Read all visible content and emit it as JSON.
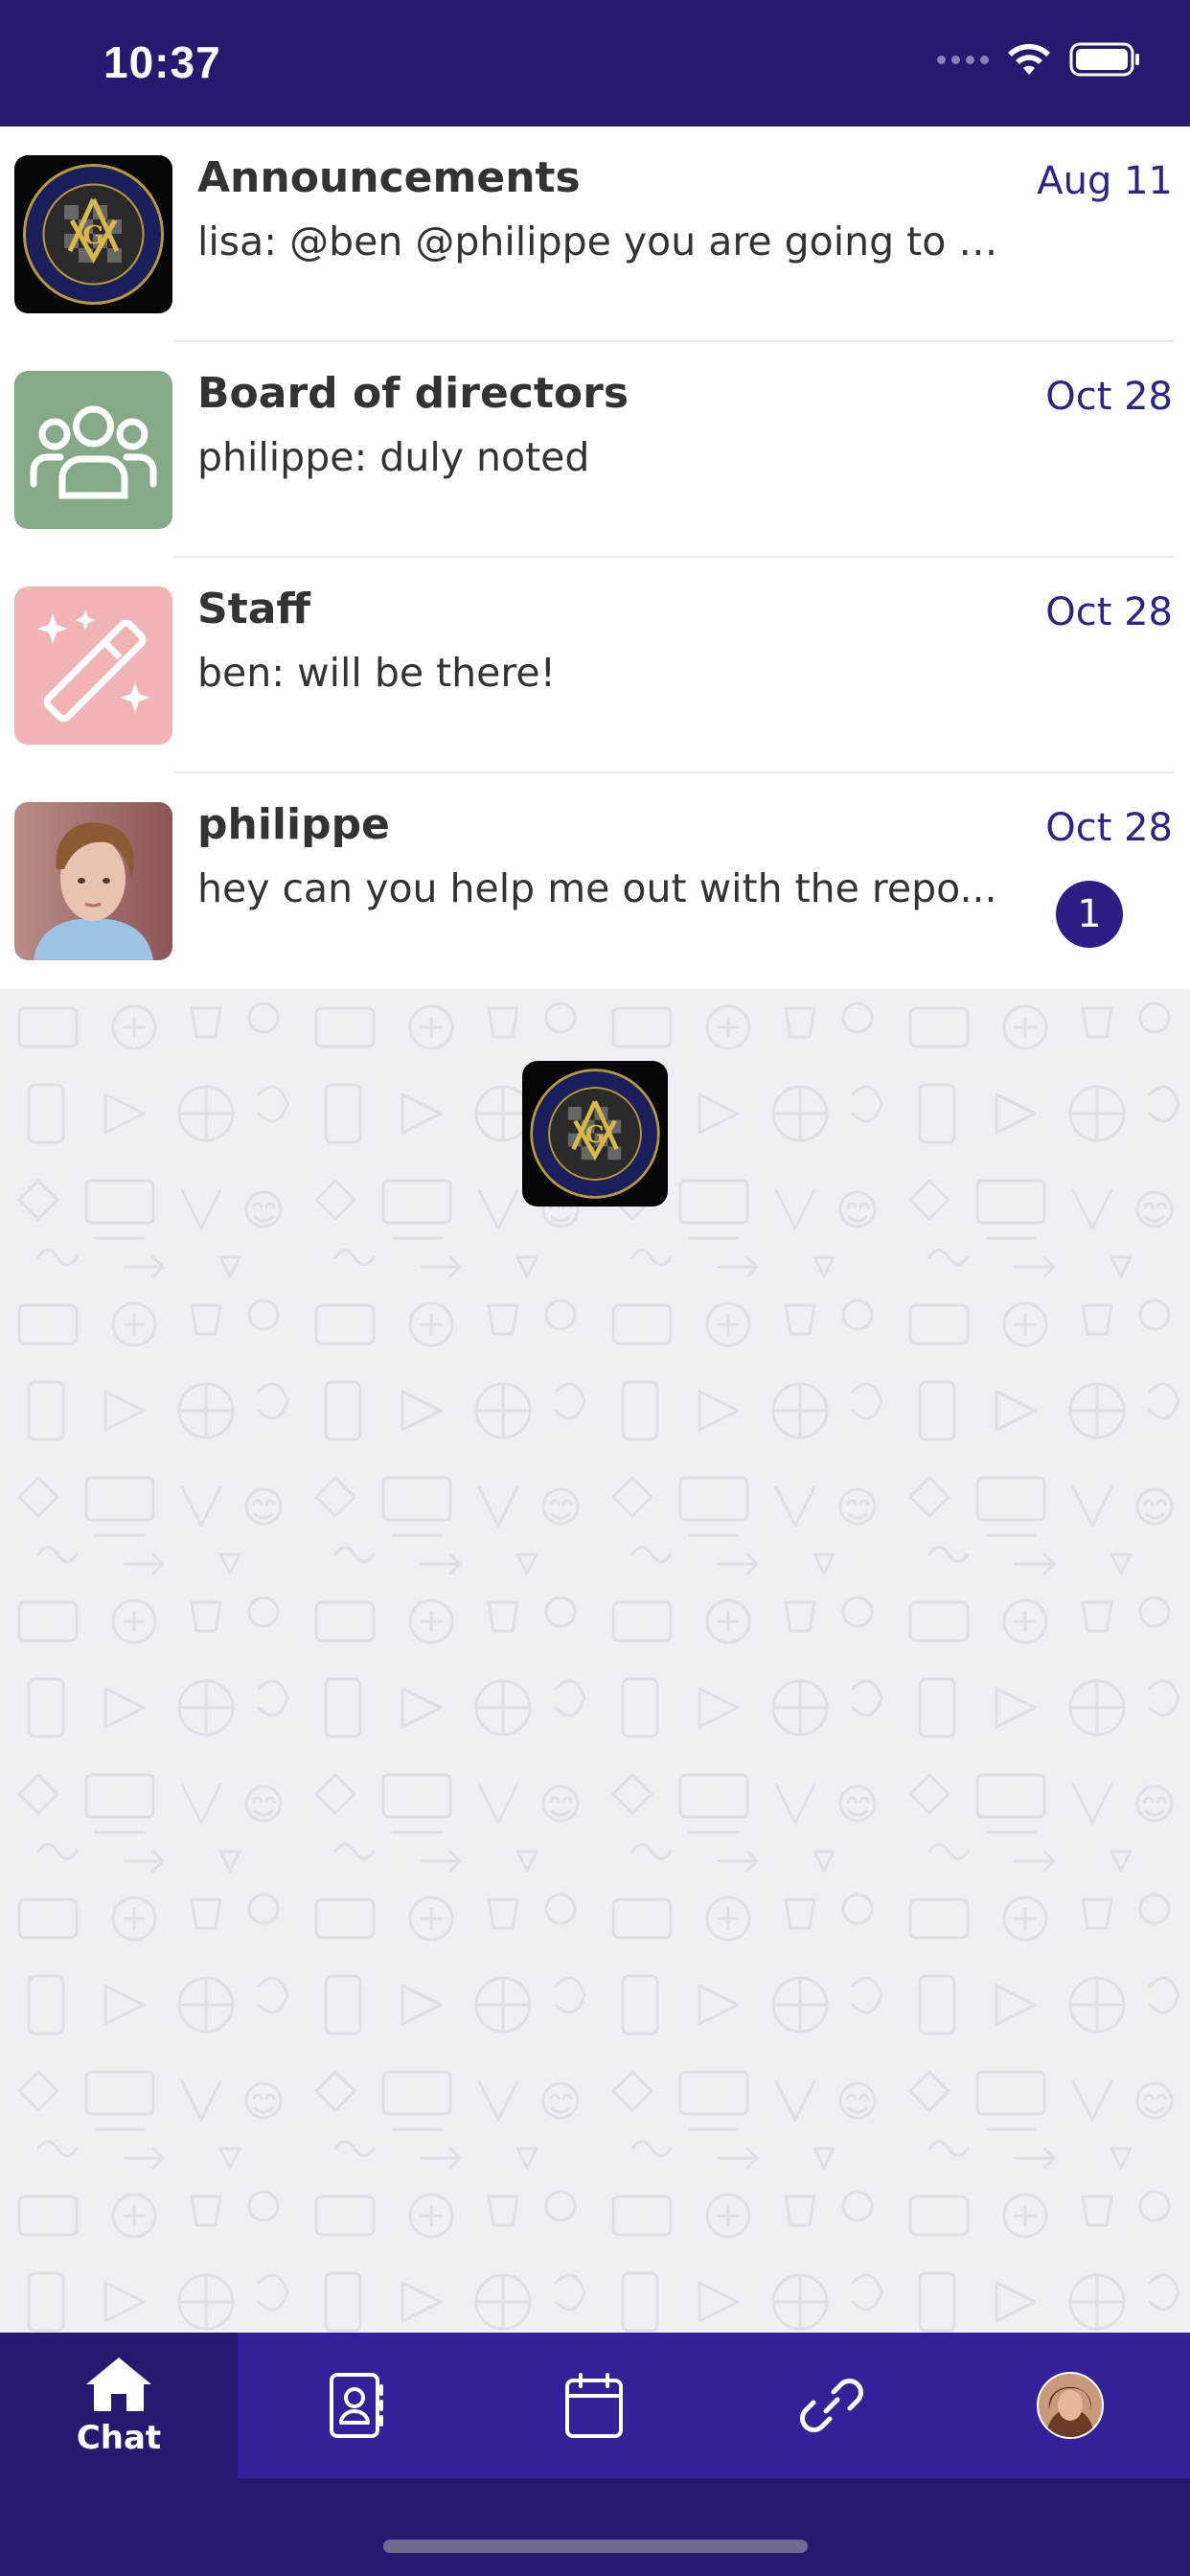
{
  "status_bar": {
    "time": "10:37"
  },
  "chats": [
    {
      "name": "Announcements",
      "preview": "lisa: @ben @philippe you are going to li...",
      "date": "Aug 11",
      "avatar": "masonic-logo"
    },
    {
      "name": "Board of directors",
      "preview": "philippe: duly noted",
      "date": "Oct 28",
      "avatar": "group-icon"
    },
    {
      "name": "Staff",
      "preview": "ben: will be there!",
      "date": "Oct 28",
      "avatar": "magic-wand-icon"
    },
    {
      "name": "philippe",
      "preview": "hey can you help me out with the repo...",
      "date": "Oct 28",
      "avatar": "user-photo",
      "unread": "1"
    }
  ],
  "tabs": [
    {
      "label": "Chat",
      "icon": "home-icon",
      "active": true
    },
    {
      "label": "",
      "icon": "contacts-icon"
    },
    {
      "label": "",
      "icon": "calendar-icon"
    },
    {
      "label": "",
      "icon": "link-icon"
    },
    {
      "label": "",
      "icon": "profile-avatar"
    }
  ],
  "colors": {
    "primary": "#261a70",
    "tab_bar": "#33219a",
    "date_text": "#2e2484",
    "group_avatar": "#86aa88",
    "staff_avatar": "#f1b3b4"
  }
}
